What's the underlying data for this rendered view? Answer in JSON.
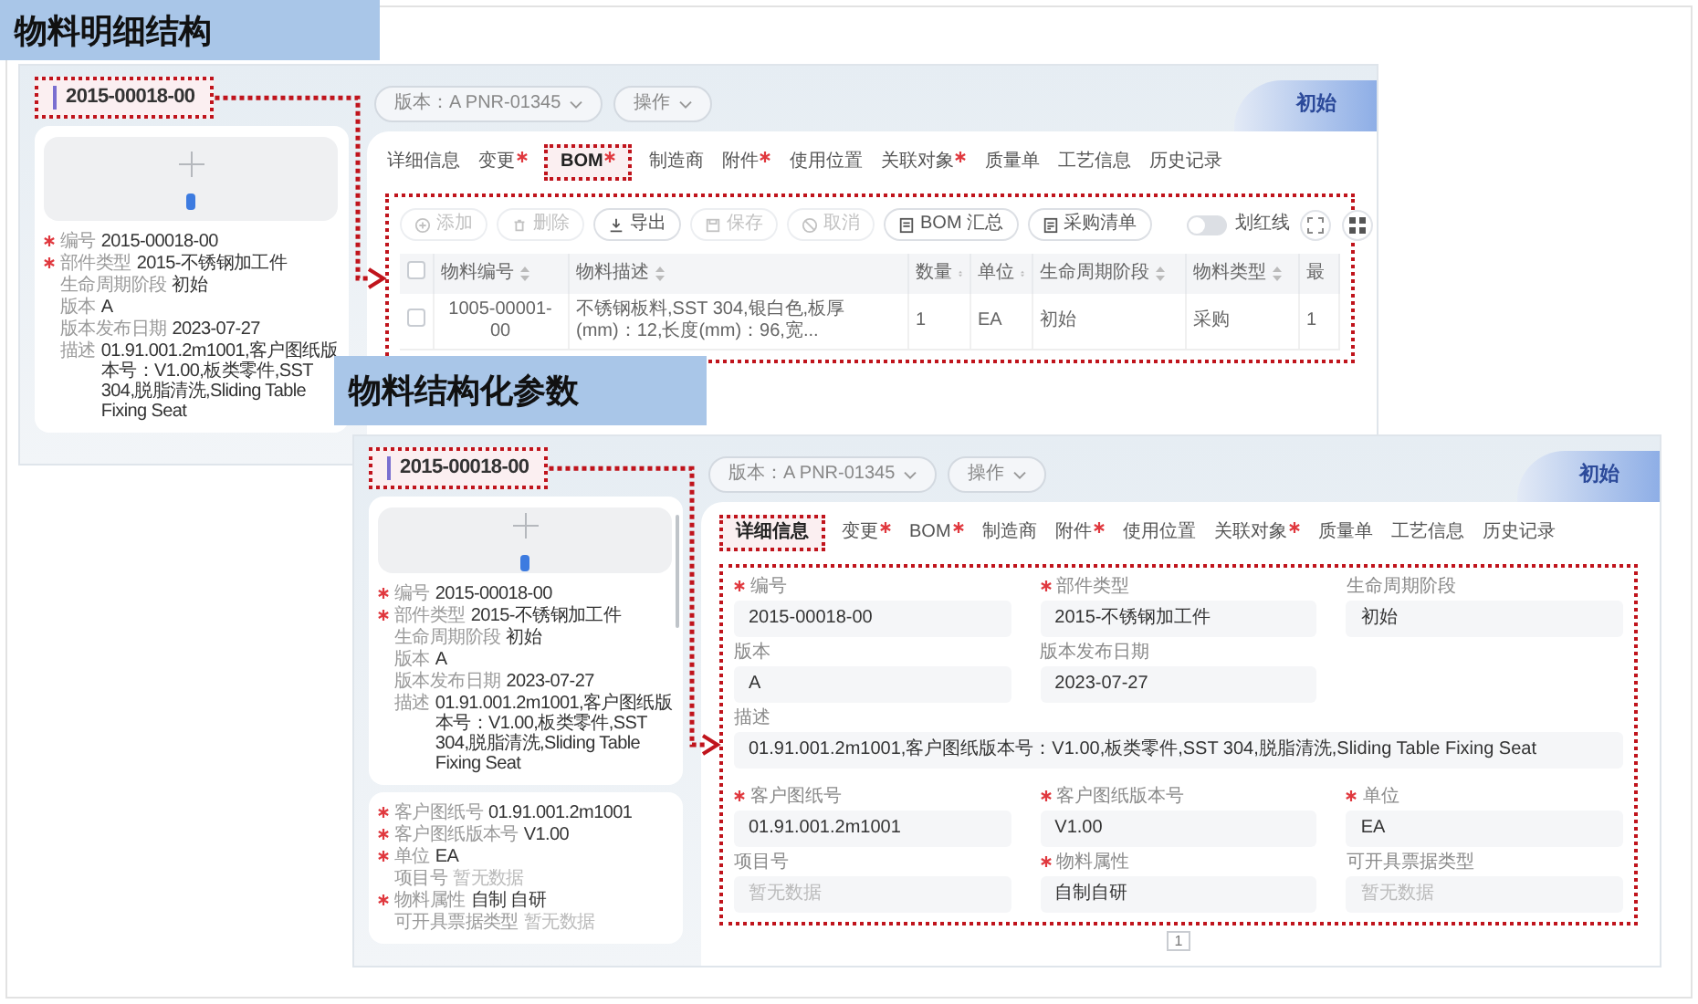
{
  "sections": [
    {
      "title": "物料明细结构",
      "screen": {
        "record_id": "2015-00018-00",
        "version_select": "版本：A PNR-01345",
        "action_select": "操作",
        "status_badge": "初始",
        "side_panel": {
          "properties": [
            {
              "label": "编号",
              "value": "2015-00018-00",
              "required": true
            },
            {
              "label": "部件类型",
              "value": "2015-不锈钢加工件",
              "required": true
            },
            {
              "label": "生命周期阶段",
              "value": "初始",
              "required": false
            },
            {
              "label": "版本",
              "value": "A",
              "required": false
            },
            {
              "label": "版本发布日期",
              "value": "2023-07-27",
              "required": false
            },
            {
              "label": "描述",
              "value": "01.91.001.2m1001,客户图纸版本号：V1.00,板类零件,SST 304,脱脂清洗,Sliding Table Fixing Seat",
              "required": false
            }
          ]
        },
        "tabs": [
          {
            "label": "详细信息",
            "marked": false,
            "selected": false
          },
          {
            "label": "变更",
            "marked": true,
            "selected": false
          },
          {
            "label": "BOM",
            "marked": true,
            "selected": true
          },
          {
            "label": "制造商",
            "marked": false,
            "selected": false
          },
          {
            "label": "附件",
            "marked": true,
            "selected": false
          },
          {
            "label": "使用位置",
            "marked": false,
            "selected": false
          },
          {
            "label": "关联对象",
            "marked": true,
            "selected": false
          },
          {
            "label": "质量单",
            "marked": false,
            "selected": false
          },
          {
            "label": "工艺信息",
            "marked": false,
            "selected": false
          },
          {
            "label": "历史记录",
            "marked": false,
            "selected": false
          }
        ],
        "content": {
          "kind": "bom",
          "toolbar": [
            {
              "label": "添加",
              "disabled": true
            },
            {
              "label": "删除",
              "disabled": true
            },
            {
              "label": "导出",
              "disabled": false
            },
            {
              "label": "保存",
              "disabled": true
            },
            {
              "label": "取消",
              "disabled": true
            },
            {
              "label": "BOM 汇总",
              "disabled": false
            },
            {
              "label": "采购清单",
              "disabled": false
            }
          ],
          "toggle": {
            "label": "划红线",
            "on": false
          },
          "table": {
            "all_checked": false,
            "columns": [
              {
                "label": "物料编号",
                "sortable": true
              },
              {
                "label": "物料描述",
                "sortable": true
              },
              {
                "label": "数量",
                "sortable": true
              },
              {
                "label": "单位",
                "sortable": true
              },
              {
                "label": "生命周期阶段",
                "sortable": true
              },
              {
                "label": "物料类型",
                "sortable": true
              },
              {
                "label": "最",
                "sortable": false
              }
            ],
            "rows": [
              {
                "checked": false,
                "cells": [
                  "1005-00001-00",
                  "不锈钢板料,SST 304,银白色,板厚(mm)：12,长度(mm)：96,宽...",
                  "1",
                  "EA",
                  "初始",
                  "采购",
                  "1"
                ]
              }
            ]
          }
        }
      }
    },
    {
      "title": "物料结构化参数",
      "screen": {
        "record_id": "2015-00018-00",
        "version_select": "版本：A PNR-01345",
        "action_select": "操作",
        "status_badge": "初始",
        "side_panel": {
          "scrollable": true,
          "properties": [
            {
              "label": "编号",
              "value": "2015-00018-00",
              "required": true
            },
            {
              "label": "部件类型",
              "value": "2015-不锈钢加工件",
              "required": true
            },
            {
              "label": "生命周期阶段",
              "value": "初始",
              "required": false
            },
            {
              "label": "版本",
              "value": "A",
              "required": false
            },
            {
              "label": "版本发布日期",
              "value": "2023-07-27",
              "required": false
            },
            {
              "label": "描述",
              "value": "01.91.001.2m1001,客户图纸版本号：V1.00,板类零件,SST 304,脱脂清洗,Sliding Table Fixing Seat",
              "required": false
            }
          ],
          "extra_properties": [
            {
              "label": "客户图纸号",
              "value": "01.91.001.2m1001",
              "required": true
            },
            {
              "label": "客户图纸版本号",
              "value": "V1.00",
              "required": true
            },
            {
              "label": "单位",
              "value": "EA",
              "required": true
            },
            {
              "label": "项目号",
              "placeholder": "暂无数据",
              "required": false
            },
            {
              "label": "物料属性",
              "value": "自制 自研",
              "required": true
            },
            {
              "label": "可开具票据类型",
              "placeholder": "暂无数据",
              "required": false
            }
          ]
        },
        "tabs": [
          {
            "label": "详细信息",
            "marked": false,
            "selected": true
          },
          {
            "label": "变更",
            "marked": true,
            "selected": false
          },
          {
            "label": "BOM",
            "marked": true,
            "selected": false
          },
          {
            "label": "制造商",
            "marked": false,
            "selected": false
          },
          {
            "label": "附件",
            "marked": true,
            "selected": false
          },
          {
            "label": "使用位置",
            "marked": false,
            "selected": false
          },
          {
            "label": "关联对象",
            "marked": true,
            "selected": false
          },
          {
            "label": "质量单",
            "marked": false,
            "selected": false
          },
          {
            "label": "工艺信息",
            "marked": false,
            "selected": false
          },
          {
            "label": "历史记录",
            "marked": false,
            "selected": false
          }
        ],
        "content": {
          "kind": "details",
          "page_number": "1",
          "field_groups": [
            [
              {
                "label": "编号",
                "value": "2015-00018-00",
                "required": true
              },
              {
                "label": "部件类型",
                "value": "2015-不锈钢加工件",
                "required": true
              },
              {
                "label": "生命周期阶段",
                "value": "初始",
                "required": false
              },
              {
                "label": "版本",
                "value": "A",
                "required": false
              },
              {
                "label": "版本发布日期",
                "value": "2023-07-27",
                "required": false
              },
              {
                "label": "描述",
                "value": "01.91.001.2m1001,客户图纸版本号：V1.00,板类零件,SST 304,脱脂清洗,Sliding Table Fixing Seat",
                "required": false,
                "wide": true
              }
            ],
            [
              {
                "label": "客户图纸号",
                "value": "01.91.001.2m1001",
                "required": true
              },
              {
                "label": "客户图纸版本号",
                "value": "V1.00",
                "required": true
              },
              {
                "label": "单位",
                "value": "EA",
                "required": true
              },
              {
                "label": "项目号",
                "placeholder": "暂无数据",
                "required": false
              },
              {
                "label": "物料属性",
                "value": "自制自研",
                "required": true
              },
              {
                "label": "可开具票据类型",
                "placeholder": "暂无数据",
                "required": false
              }
            ]
          ]
        }
      }
    }
  ]
}
